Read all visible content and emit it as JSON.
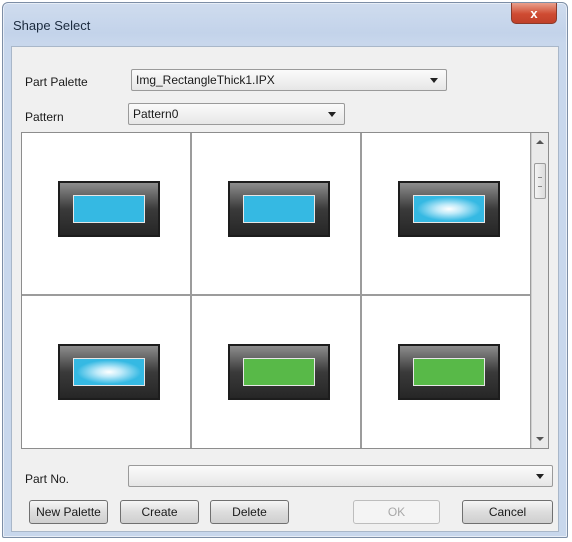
{
  "window": {
    "title": "Shape Select",
    "close_label": "x"
  },
  "part_palette": {
    "label": "Part Palette",
    "value": "Img_RectangleThick1.IPX"
  },
  "pattern": {
    "label": "Pattern",
    "value": "Pattern0"
  },
  "shapes": [
    {
      "face_color": "#35b9e3",
      "style": "flat"
    },
    {
      "face_color": "#35b9e3",
      "style": "flat"
    },
    {
      "face_color": "#35b9e3",
      "style": "glow"
    },
    {
      "face_color": "#35b9e3",
      "style": "glow"
    },
    {
      "face_color": "#58b948",
      "style": "flat"
    },
    {
      "face_color": "#58b948",
      "style": "flat"
    }
  ],
  "part_no": {
    "label": "Part No.",
    "value": ""
  },
  "buttons": {
    "new_palette": "New Palette",
    "create": "Create",
    "delete": "Delete",
    "ok": "OK",
    "cancel": "Cancel"
  }
}
